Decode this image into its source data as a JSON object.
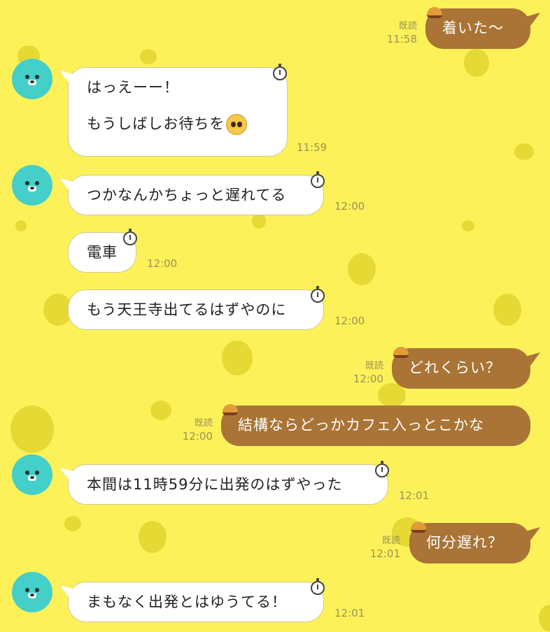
{
  "messages": [
    {
      "id": "m1",
      "side": "out",
      "text": "着いた〜",
      "read": "既読",
      "time": "11:58"
    },
    {
      "id": "m2",
      "side": "in",
      "line1": "はっえーー！",
      "line2": "もうしばしお待ちを",
      "emoji": "pleading-face-emoji",
      "time": "11:59"
    },
    {
      "id": "m3",
      "side": "in",
      "text": "つかなんかちょっと遅れてる",
      "time": "12:00"
    },
    {
      "id": "m4",
      "side": "in",
      "text": "電車",
      "time": "12:00"
    },
    {
      "id": "m5",
      "side": "in",
      "text": "もう天王寺出てるはずやのに",
      "time": "12:00"
    },
    {
      "id": "m6",
      "side": "out",
      "text": "どれくらい？",
      "read": "既読",
      "time": "12:00"
    },
    {
      "id": "m7",
      "side": "out",
      "text": "結構ならどっかカフェ入っとこかな",
      "read": "既読",
      "time": "12:00"
    },
    {
      "id": "m8",
      "side": "in",
      "text": "本間は11時59分に出発のはずやった",
      "time": "12:01"
    },
    {
      "id": "m9",
      "side": "out",
      "text": "何分遅れ？",
      "read": "既読",
      "time": "12:01"
    },
    {
      "id": "m10",
      "side": "in",
      "text": "まもなく出発とはゆうてる！",
      "time": "12:01"
    }
  ],
  "colors": {
    "background": "#fdf15a",
    "outgoing_bubble": "#a97435",
    "incoming_bubble": "#ffffff",
    "avatar": "#44cfc9"
  },
  "icons": [
    "bear-avatar-icon",
    "stopwatch-icon",
    "burger-icon"
  ]
}
